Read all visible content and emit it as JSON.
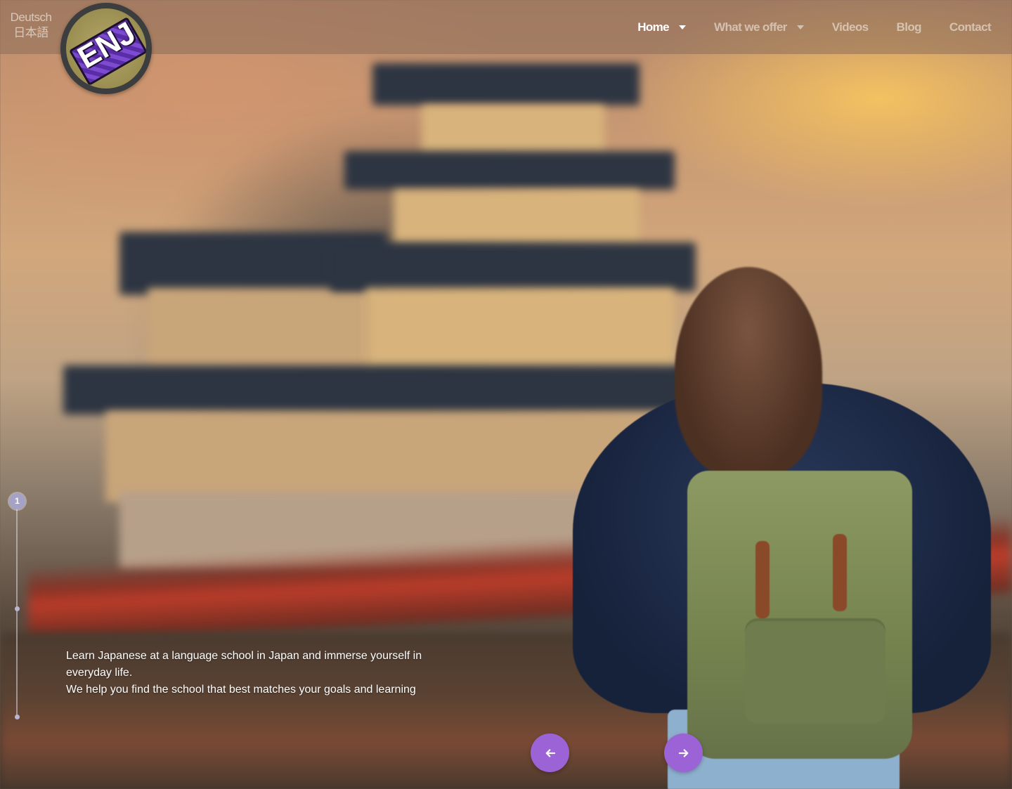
{
  "languages": [
    "Deutsch",
    "日本語"
  ],
  "logo": {
    "text": "ENJ"
  },
  "nav": {
    "items": [
      {
        "label": "Home",
        "has_dropdown": true,
        "active": true
      },
      {
        "label": "What we offer",
        "has_dropdown": true,
        "active": false
      },
      {
        "label": "Videos",
        "has_dropdown": false,
        "active": false
      },
      {
        "label": "Blog",
        "has_dropdown": false,
        "active": false
      },
      {
        "label": "Contact",
        "has_dropdown": false,
        "active": false
      }
    ]
  },
  "slider": {
    "current": "1",
    "total_slides": 3,
    "caption_line1": "Learn Japanese at a language school in Japan and immerse yourself in everyday life.",
    "caption_line2": "We help you find the school that best matches your goals and learning"
  },
  "icons": {
    "prev": "arrow-left-icon",
    "next": "arrow-right-icon",
    "dropdown": "caret-down-icon"
  },
  "colors": {
    "accent": "#9b63d6",
    "nav_active": "#ffffff",
    "nav_inactive": "#f0e8e0",
    "pagination": "#a5a2c8"
  }
}
